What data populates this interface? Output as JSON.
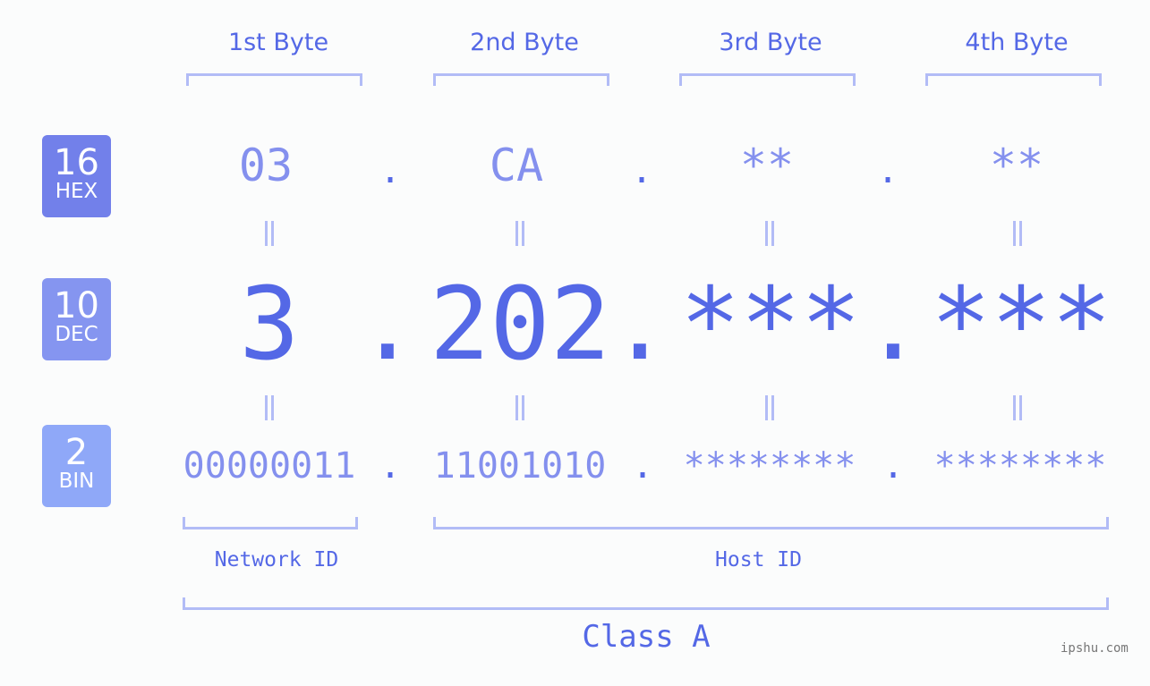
{
  "bytes": [
    {
      "label": "1st Byte",
      "hex": "03",
      "dec": "3",
      "bin": "00000011"
    },
    {
      "label": "2nd Byte",
      "hex": "CA",
      "dec": "202",
      "bin": "11001010"
    },
    {
      "label": "3rd Byte",
      "hex": "**",
      "dec": "***",
      "bin": "********"
    },
    {
      "label": "4th Byte",
      "hex": "**",
      "dec": "***",
      "bin": "********"
    }
  ],
  "separator": ".",
  "badges": {
    "hex": {
      "num": "16",
      "label": "HEX",
      "color": "#7280ea"
    },
    "dec": {
      "num": "10",
      "label": "DEC",
      "color": "#8595f0"
    },
    "bin": {
      "num": "2",
      "label": "BIN",
      "color": "#8fa8f8"
    }
  },
  "network_id_label": "Network ID",
  "host_id_label": "Host ID",
  "class_label": "Class A",
  "watermark": "ipshu.com"
}
